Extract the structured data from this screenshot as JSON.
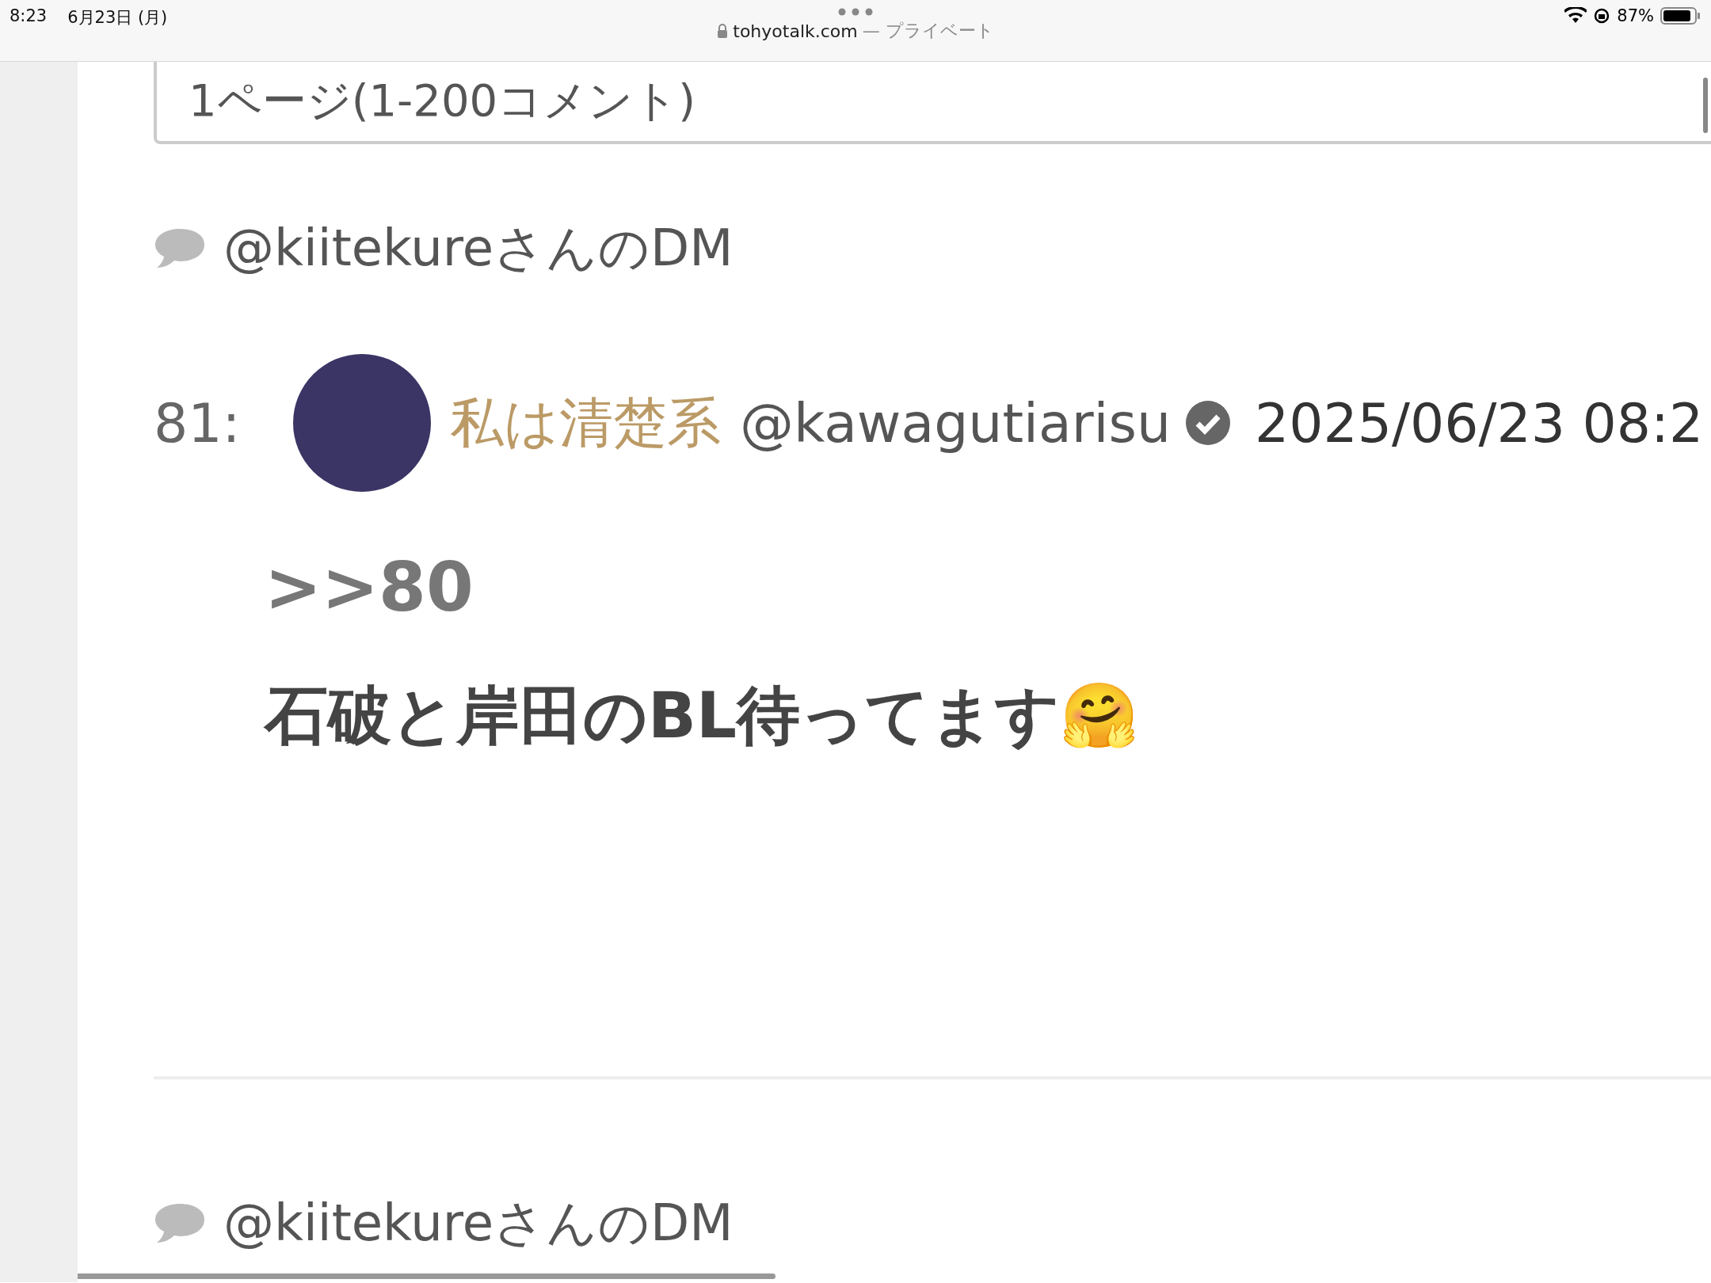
{
  "status_bar": {
    "time": "8:23",
    "date": "6月23日 (月)",
    "url": "tohyotalk.com",
    "url_note": "— プライベート",
    "battery": "87%"
  },
  "page_selector": {
    "label": "1ページ(1-200コメント)"
  },
  "sections": [
    {
      "heading": "@kiitekureさんのDM",
      "post": {
        "number": "81:",
        "name": "私は清楚系",
        "handle": "@kawagutiarisu",
        "verified": true,
        "datetime": "2025/06/23 08:2",
        "reply_to": ">>80",
        "body": "石破と岸田のBL待ってます🤗"
      }
    },
    {
      "heading": "@kiitekureさんのDM"
    }
  ]
}
